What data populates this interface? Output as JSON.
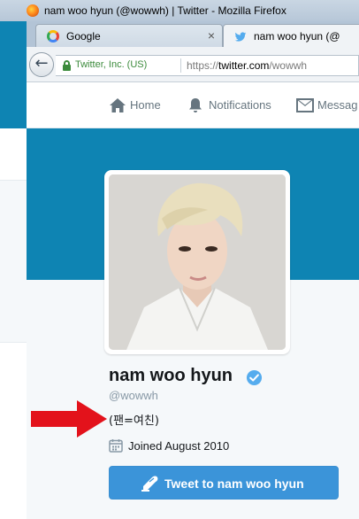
{
  "window": {
    "title": "nam woo hyun (@wowwh) | Twitter - Mozilla Firefox"
  },
  "tabs": [
    {
      "label": "Google",
      "icon": "google-icon",
      "active": false,
      "close": "×"
    },
    {
      "label": "nam woo hyun (@",
      "icon": "twitter-bird-icon",
      "active": true
    }
  ],
  "navbar": {
    "back_symbol": "←",
    "identity": "Twitter, Inc. (US)",
    "url_prefix": "https://",
    "url_domain": "twitter.com",
    "url_path": "/wowwh"
  },
  "twitter_nav": {
    "home": "Home",
    "notifications": "Notifications",
    "messages": "Messag"
  },
  "profile": {
    "name": "nam woo hyun",
    "handle": "@wowwh",
    "bio": "(팬=여친)",
    "joined": "Joined August 2010",
    "tweet_button": "Tweet to nam woo hyun"
  },
  "colors": {
    "banner": "#0e84b3",
    "twitter_blue": "#3b94d9",
    "verified": "#55acee",
    "annotation_arrow": "#e3121b"
  }
}
